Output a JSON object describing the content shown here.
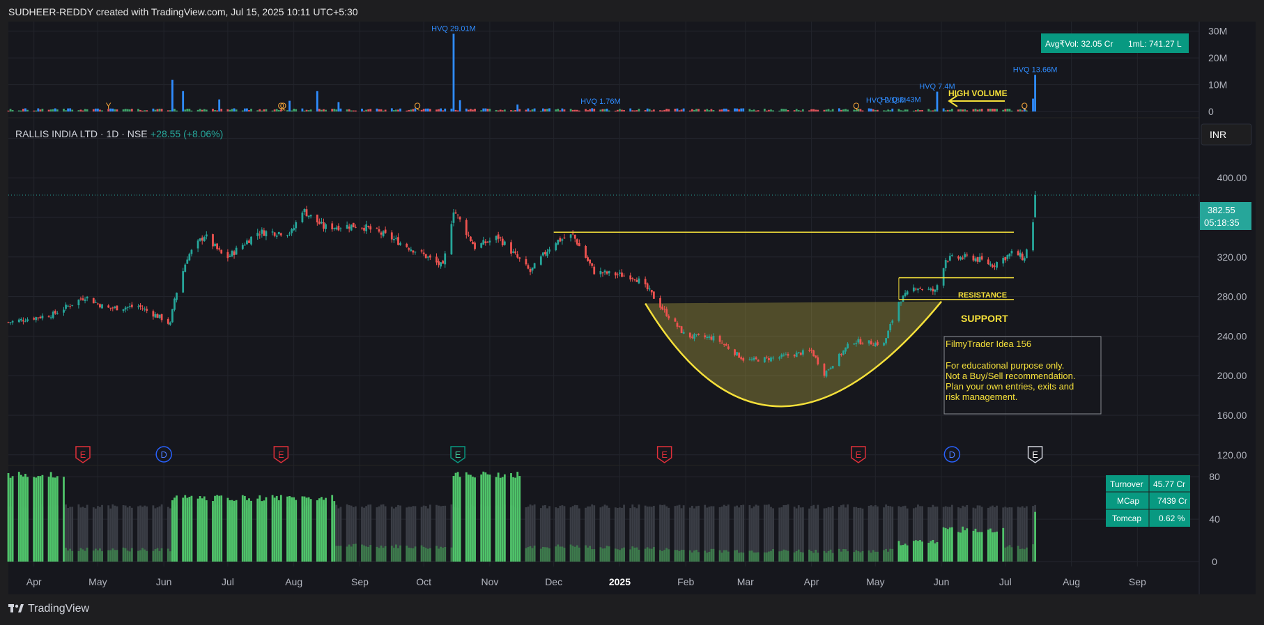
{
  "header": {
    "credit": "SUDHEER-REDDY created with TradingView.com, Jul 15, 2025 10:11 UTC+5:30"
  },
  "footer": {
    "brand": "TradingView"
  },
  "symbol": {
    "name": "RALLIS INDIA LTD · 1D · NSE",
    "change": "+28.55 (+8.06%)",
    "currency": "INR"
  },
  "price_tag": {
    "price": "382.55",
    "timer": "05:18:35",
    "value": 382.55
  },
  "volume_badges": {
    "avg_vol": "Avg₹Vol: 32.05 Cr",
    "one_ml": "1mL: 741.27 L"
  },
  "turnover_table": {
    "rows": [
      {
        "label": "Turnover",
        "value": "45.77 Cr"
      },
      {
        "label": "MCap",
        "value": "7439 Cr"
      },
      {
        "label": "Tomcap",
        "value": "0.62 %"
      }
    ]
  },
  "annotations": {
    "high_volume": "HIGH VOLUME",
    "resistance": "RESISTANCE",
    "support": "SUPPORT",
    "idea_title": "FilmyTrader Idea  156",
    "idea_lines": [
      "For educational purpose only.",
      "Not a Buy/Sell recommendation.",
      "Plan your own entries, exits and",
      "risk management."
    ]
  },
  "colors": {
    "background": "#1e1e20",
    "pane": "#16171d",
    "up": "#26a69a",
    "down": "#ef5350",
    "vol_blue": "#2f8cff",
    "vol_red": "#e0545a",
    "vol_green": "#3fa36a",
    "accent_yellow": "#f5e03a",
    "badge_green": "#089981",
    "hvq_text": "#2f8cff",
    "q_marker": "#f0a23a"
  },
  "chart_data": [
    {
      "type": "bar",
      "title": "Volume",
      "y_ticks": [
        "30M",
        "20M",
        "10M",
        "0"
      ],
      "ylim": [
        0,
        32
      ],
      "unit": "M",
      "hvq_labels": [
        {
          "text": "HVQ 29.01M",
          "date": "2024-10-15",
          "value": 29.01
        },
        {
          "text": "HVQ 1.76M",
          "date": "2024-12-23",
          "value": 1.76
        },
        {
          "text": "HVQ 2.18M",
          "date": "2025-05-06",
          "value": 2.18
        },
        {
          "text": "HVQ 2.43M",
          "date": "2025-05-13",
          "value": 2.43
        },
        {
          "text": "HVQ 7.4M",
          "date": "2025-05-30",
          "value": 7.4
        },
        {
          "text": "HVQ 13.66M",
          "date": "2025-07-15",
          "value": 13.66
        }
      ],
      "event_markers": [
        {
          "text": "Y",
          "date": "2024-05-06"
        },
        {
          "text": "Q",
          "date": "2024-07-26"
        },
        {
          "text": "Q",
          "date": "2024-07-27"
        },
        {
          "text": "Q",
          "date": "2024-09-28"
        },
        {
          "text": "Q",
          "date": "2025-04-22"
        },
        {
          "text": "Q",
          "date": "2025-07-10"
        }
      ],
      "spikes": [
        {
          "date": "2024-06-05",
          "value": 11.8
        },
        {
          "date": "2024-06-10",
          "value": 7.6
        },
        {
          "date": "2024-06-27",
          "value": 4.5
        },
        {
          "date": "2024-07-30",
          "value": 4.0
        },
        {
          "date": "2024-08-12",
          "value": 7.6
        },
        {
          "date": "2024-08-22",
          "value": 3.5
        },
        {
          "date": "2024-10-15",
          "value": 29.01
        },
        {
          "date": "2024-10-18",
          "value": 4.2
        },
        {
          "date": "2024-11-14",
          "value": 2.6
        },
        {
          "date": "2025-05-30",
          "value": 7.4
        },
        {
          "date": "2025-07-14",
          "value": 4.8
        },
        {
          "date": "2025-07-15",
          "value": 13.66
        }
      ]
    },
    {
      "type": "candlestick",
      "title": "RALLIS INDIA LTD · 1D · NSE",
      "ylabel": "INR",
      "y_ticks": [
        440,
        400,
        360,
        320,
        280,
        240,
        200,
        160,
        120
      ],
      "ylim": [
        110,
        460
      ],
      "x_ticks": [
        "Apr",
        "May",
        "Jun",
        "Jul",
        "Aug",
        "Sep",
        "Oct",
        "Nov",
        "Dec",
        "2025",
        "Feb",
        "Mar",
        "Apr",
        "May",
        "Jun",
        "Jul",
        "Aug",
        "Sep"
      ],
      "x_tick_dates": [
        "2024-04-01",
        "2024-05-01",
        "2024-06-01",
        "2024-07-01",
        "2024-08-01",
        "2024-09-01",
        "2024-10-01",
        "2024-11-01",
        "2024-12-01",
        "2025-01-01",
        "2025-02-01",
        "2025-03-01",
        "2025-04-01",
        "2025-05-01",
        "2025-06-01",
        "2025-07-01",
        "2025-08-01",
        "2025-09-01"
      ],
      "x_range": [
        "2024-03-20",
        "2025-09-30"
      ],
      "last_price": 382.55,
      "close_path": [
        {
          "date": "2024-03-20",
          "close": 254
        },
        {
          "date": "2024-04-10",
          "close": 262
        },
        {
          "date": "2024-04-25",
          "close": 280
        },
        {
          "date": "2024-05-05",
          "close": 268
        },
        {
          "date": "2024-05-20",
          "close": 270
        },
        {
          "date": "2024-05-31",
          "close": 258
        },
        {
          "date": "2024-06-04",
          "close": 252
        },
        {
          "date": "2024-06-06",
          "close": 278
        },
        {
          "date": "2024-06-12",
          "close": 320
        },
        {
          "date": "2024-06-20",
          "close": 342
        },
        {
          "date": "2024-06-30",
          "close": 318
        },
        {
          "date": "2024-07-15",
          "close": 345
        },
        {
          "date": "2024-07-31",
          "close": 345
        },
        {
          "date": "2024-08-05",
          "close": 368
        },
        {
          "date": "2024-08-15",
          "close": 350
        },
        {
          "date": "2024-09-01",
          "close": 352
        },
        {
          "date": "2024-09-15",
          "close": 340
        },
        {
          "date": "2024-10-01",
          "close": 322
        },
        {
          "date": "2024-10-10",
          "close": 310
        },
        {
          "date": "2024-10-15",
          "close": 368
        },
        {
          "date": "2024-10-25",
          "close": 330
        },
        {
          "date": "2024-11-05",
          "close": 340
        },
        {
          "date": "2024-11-20",
          "close": 305
        },
        {
          "date": "2024-12-01",
          "close": 335
        },
        {
          "date": "2024-12-10",
          "close": 342
        },
        {
          "date": "2024-12-20",
          "close": 305
        },
        {
          "date": "2025-01-08",
          "close": 300
        },
        {
          "date": "2025-01-15",
          "close": 285
        },
        {
          "date": "2025-01-22",
          "close": 265
        },
        {
          "date": "2025-02-01",
          "close": 240
        },
        {
          "date": "2025-02-15",
          "close": 238
        },
        {
          "date": "2025-03-01",
          "close": 215
        },
        {
          "date": "2025-03-15",
          "close": 218
        },
        {
          "date": "2025-04-01",
          "close": 225
        },
        {
          "date": "2025-04-07",
          "close": 202
        },
        {
          "date": "2025-04-20",
          "close": 235
        },
        {
          "date": "2025-05-05",
          "close": 232
        },
        {
          "date": "2025-05-12",
          "close": 275
        },
        {
          "date": "2025-05-20",
          "close": 290
        },
        {
          "date": "2025-05-29",
          "close": 285
        },
        {
          "date": "2025-06-03",
          "close": 318
        },
        {
          "date": "2025-06-15",
          "close": 320
        },
        {
          "date": "2025-06-25",
          "close": 312
        },
        {
          "date": "2025-07-05",
          "close": 325
        },
        {
          "date": "2025-07-10",
          "close": 318
        },
        {
          "date": "2025-07-12",
          "close": 340
        },
        {
          "date": "2025-07-14",
          "close": 354
        },
        {
          "date": "2025-07-15",
          "close": 382.55
        }
      ],
      "lines": [
        {
          "name": "neckline",
          "from": {
            "date": "2024-12-01",
            "value": 345
          },
          "to": {
            "date": "2025-07-05",
            "value": 345
          }
        },
        {
          "name": "resistance-upper",
          "from": {
            "date": "2025-05-12",
            "value": 299
          },
          "to": {
            "date": "2025-07-05",
            "value": 299
          }
        },
        {
          "name": "support",
          "from": {
            "date": "2025-05-12",
            "value": 277
          },
          "to": {
            "date": "2025-07-05",
            "value": 277
          }
        }
      ],
      "cup": {
        "left": {
          "date": "2025-01-13",
          "value": 273
        },
        "right": {
          "date": "2025-06-01",
          "value": 275
        },
        "bottom": {
          "date": "2025-03-18",
          "value": 169
        }
      },
      "earnings_markers": [
        {
          "text": "E",
          "date": "2024-04-24",
          "kind": "earnings-red"
        },
        {
          "text": "D",
          "date": "2024-06-01",
          "kind": "dividend"
        },
        {
          "text": "E",
          "date": "2024-07-26",
          "kind": "earnings-red"
        },
        {
          "text": "E",
          "date": "2024-10-17",
          "kind": "earnings-green"
        },
        {
          "text": "E",
          "date": "2025-01-22",
          "kind": "earnings-red"
        },
        {
          "text": "E",
          "date": "2025-04-23",
          "kind": "earnings-red"
        },
        {
          "text": "D",
          "date": "2025-06-06",
          "kind": "dividend"
        },
        {
          "text": "E",
          "date": "2025-07-15",
          "kind": "earnings-white"
        }
      ]
    },
    {
      "type": "bar",
      "title": "Turnover indicator",
      "y_ticks": [
        80,
        40,
        0
      ],
      "ylim": [
        0,
        90
      ],
      "bright_segments": [
        {
          "from": "2024-03-20",
          "to": "2024-04-15",
          "value": 82
        },
        {
          "from": "2024-06-05",
          "to": "2024-08-20",
          "value": 60
        },
        {
          "from": "2024-10-15",
          "to": "2024-11-15",
          "value": 82
        },
        {
          "from": "2025-05-12",
          "to": "2025-05-30",
          "value": 18
        },
        {
          "from": "2025-06-01",
          "to": "2025-06-30",
          "value": 30
        },
        {
          "from": "2025-07-15",
          "to": "2025-07-15",
          "value": 47
        }
      ],
      "background_value": 52
    }
  ]
}
